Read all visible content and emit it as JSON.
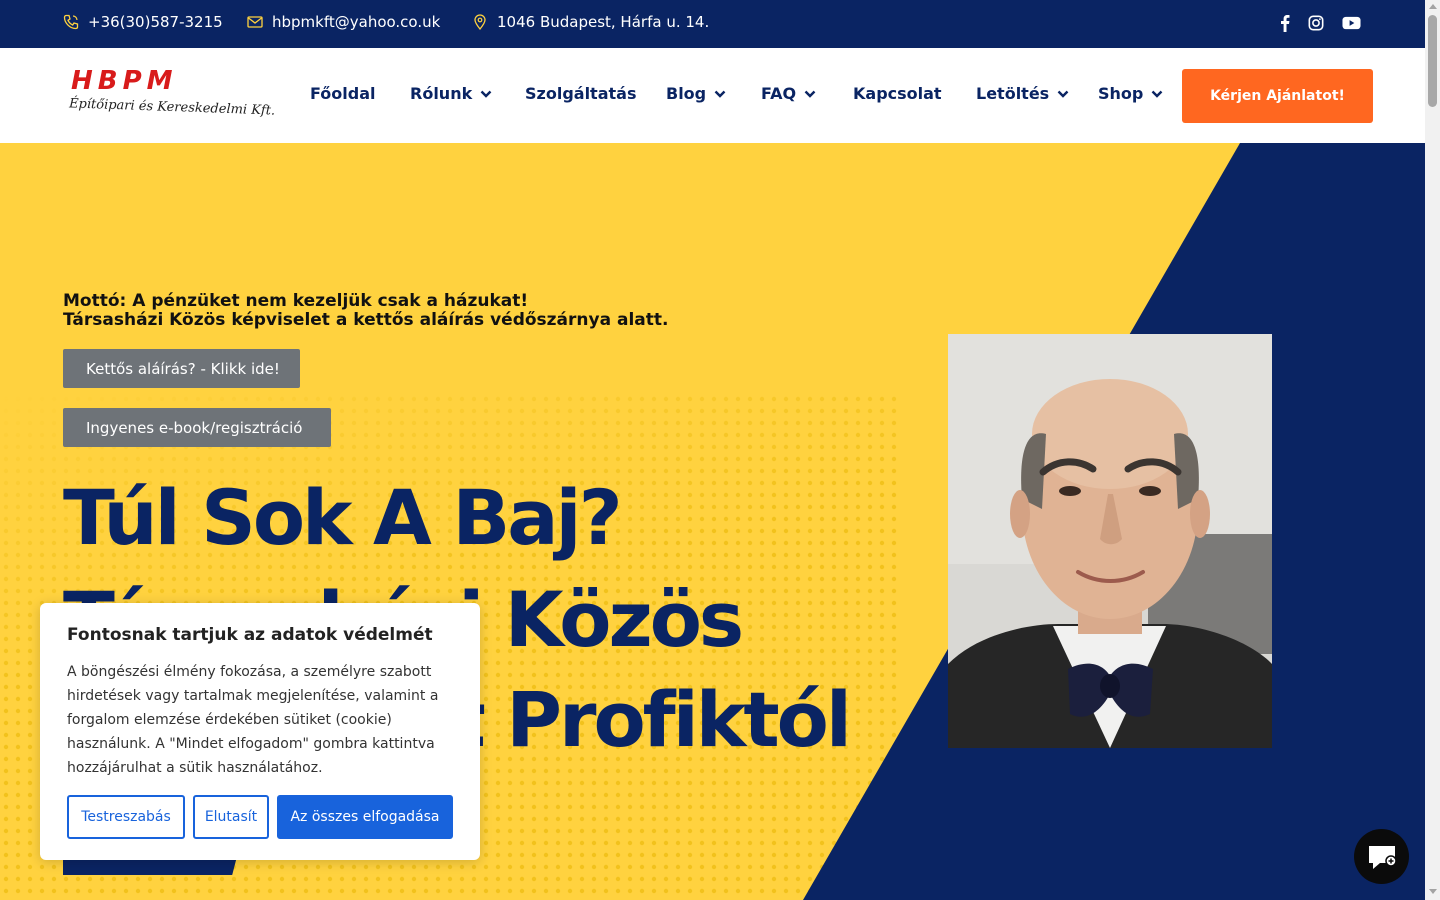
{
  "topbar": {
    "phone": "+36(30)587-3215",
    "email": "hbpmkft@yahoo.co.uk",
    "address": "1046 Budapest, Hárfa u. 14.",
    "social_icons": [
      "facebook-icon",
      "instagram-icon",
      "youtube-icon"
    ]
  },
  "logo": {
    "main": "HBPM",
    "sub": "Építőipari és Kereskedelmi Kft."
  },
  "nav": {
    "items": [
      {
        "label": "Főoldal",
        "dropdown": false
      },
      {
        "label": "Rólunk",
        "dropdown": true
      },
      {
        "label": "Szolgáltatás",
        "dropdown": false
      },
      {
        "label": "Blog",
        "dropdown": true
      },
      {
        "label": "FAQ",
        "dropdown": true
      },
      {
        "label": "Kapcsolat",
        "dropdown": false
      },
      {
        "label": "Letöltés",
        "dropdown": true
      },
      {
        "label": "Shop",
        "dropdown": true
      }
    ],
    "cta_label": "Kérjen Ajánlatot!"
  },
  "hero": {
    "motto_line1": "Mottó: A pénzüket nem kezeljük csak a házukat!",
    "motto_line2": "Társasházi Közös képviselet a kettős aláírás védőszárnya alatt.",
    "button1": "Kettős aláírás? - Klikk ide!",
    "button2": "Ingyenes e-book/regisztráció",
    "headline_line1": "Túl Sok A Baj?",
    "headline_line2": "Társasházi Közös",
    "headline_line3": "Képviselet Profiktól"
  },
  "cookie": {
    "title": "Fontosnak tartjuk az adatok védelmét",
    "text": "A böngészési élmény fokozása, a személyre szabott hirdetések vagy tartalmak megjelenítése, valamint a forgalom elemzése érdekében sütiket (cookie) használunk. A \"Mindet elfogadom\" gombra kattintva hozzájárulhat a sütik használatához.",
    "btn_customize": "Testreszabás",
    "btn_reject": "Elutasít",
    "btn_accept": "Az összes elfogadása"
  },
  "colors": {
    "navy": "#0a2463",
    "yellow": "#ffd23f",
    "orange": "#ff6720",
    "cookie_blue": "#1863dc",
    "logo_red": "#d81b1b"
  }
}
